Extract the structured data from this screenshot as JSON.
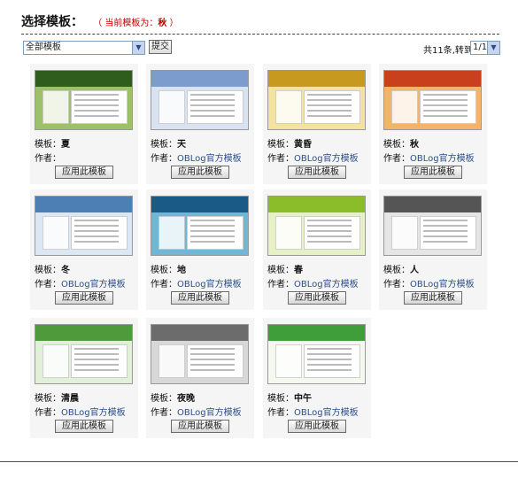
{
  "header": {
    "title": "选择模板：",
    "current_prefix": "（ 当前模板为：",
    "current_value": "秋",
    "current_suffix": " ）"
  },
  "toolbar": {
    "filter_value": "全部模板",
    "submit_label": "提交",
    "pager_text": "共11条,转到",
    "page_value": "1/1"
  },
  "labels": {
    "name_prefix": "模板：",
    "author_prefix": "作者：",
    "apply_label": "应用此模板"
  },
  "templates": [
    {
      "name": "夏",
      "author": "",
      "colors": [
        "#2e5d1d",
        "#9ec06a"
      ]
    },
    {
      "name": "天",
      "author": "OBLog官方模板",
      "colors": [
        "#7b9ccc",
        "#d8e2f0"
      ]
    },
    {
      "name": "黄昏",
      "author": "OBLog官方模板",
      "colors": [
        "#c79a1f",
        "#f3e3a0"
      ]
    },
    {
      "name": "秋",
      "author": "OBLog官方模板",
      "colors": [
        "#c8401c",
        "#f2b36a"
      ]
    },
    {
      "name": "冬",
      "author": "OBLog官方模板",
      "colors": [
        "#4d7fb5",
        "#dbe8f3"
      ]
    },
    {
      "name": "地",
      "author": "OBLog官方模板",
      "colors": [
        "#1a5a86",
        "#6fb6d8"
      ]
    },
    {
      "name": "春",
      "author": "OBLog官方模板",
      "colors": [
        "#8bbd2a",
        "#e6f2c5"
      ]
    },
    {
      "name": "人",
      "author": "OBLog官方模板",
      "colors": [
        "#555555",
        "#e5e5e5"
      ]
    },
    {
      "name": "清晨",
      "author": "OBLog官方模板",
      "colors": [
        "#4f9a3a",
        "#e2efd9"
      ]
    },
    {
      "name": "夜晚",
      "author": "OBLog官方模板",
      "colors": [
        "#6c6c6c",
        "#d8d8d8"
      ]
    },
    {
      "name": "中午",
      "author": "OBLog官方模板",
      "colors": [
        "#3f9d3a",
        "#f4f8ee"
      ]
    }
  ]
}
